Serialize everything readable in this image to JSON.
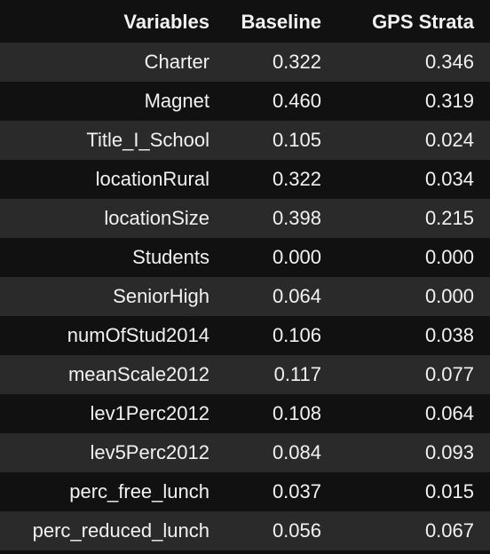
{
  "table": {
    "headers": [
      "Variables",
      "Baseline",
      "GPS Strata"
    ],
    "rows": [
      [
        "Charter",
        "0.322",
        "0.346"
      ],
      [
        "Magnet",
        "0.460",
        "0.319"
      ],
      [
        "Title_I_School",
        "0.105",
        "0.024"
      ],
      [
        "locationRural",
        "0.322",
        "0.034"
      ],
      [
        "locationSize",
        "0.398",
        "0.215"
      ],
      [
        "Students",
        "0.000",
        "0.000"
      ],
      [
        "SeniorHigh",
        "0.064",
        "0.000"
      ],
      [
        "numOfStud2014",
        "0.106",
        "0.038"
      ],
      [
        "meanScale2012",
        "0.117",
        "0.077"
      ],
      [
        "lev1Perc2012",
        "0.108",
        "0.064"
      ],
      [
        "lev5Perc2012",
        "0.084",
        "0.093"
      ],
      [
        "perc_free_lunch",
        "0.037",
        "0.015"
      ],
      [
        "perc_reduced_lunch",
        "0.056",
        "0.067"
      ]
    ]
  },
  "colors": {
    "background": "#111111",
    "stripe": "#2a2a2a",
    "text": "#f2f2f2"
  }
}
